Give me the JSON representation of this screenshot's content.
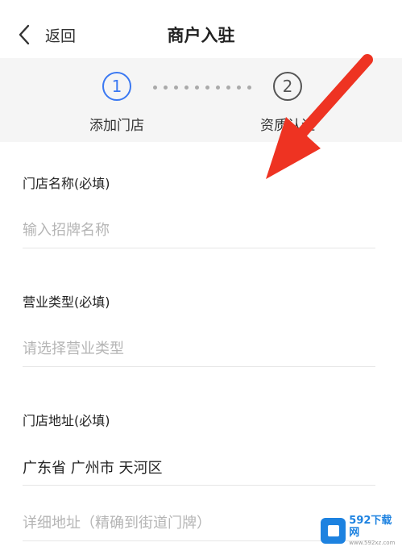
{
  "header": {
    "back_label": "返回",
    "title": "商户入驻"
  },
  "steps": [
    {
      "number": "1",
      "label": "添加门店",
      "active": true
    },
    {
      "number": "2",
      "label": "资质认证",
      "active": false
    }
  ],
  "form": {
    "store_name": {
      "label": "门店名称(必填)",
      "placeholder": "输入招牌名称"
    },
    "business_type": {
      "label": "营业类型(必填)",
      "placeholder": "请选择营业类型"
    },
    "store_address": {
      "label": "门店地址(必填)",
      "region_value": "广东省 广州市 天河区",
      "detail_placeholder": "详细地址（精确到街道门牌）"
    }
  },
  "colors": {
    "accent": "#3a78f2",
    "arrow": "#ee3322",
    "divider": "#e6e6e6"
  },
  "watermark": {
    "main": "592下载网",
    "sub": "www.592xz.com"
  }
}
